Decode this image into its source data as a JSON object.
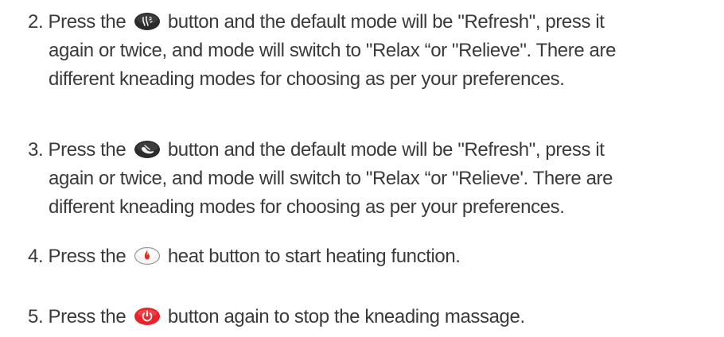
{
  "steps": [
    {
      "number": "2.",
      "lines": [
        {
          "before": "Press the",
          "after": "button and the default mode will be \"Refresh\", press it"
        },
        {
          "text": "again or twice, and mode will switch to \"Relax “or \"Relieve\". There are"
        },
        {
          "text": "different kneading modes for choosing as per your preferences."
        }
      ],
      "icon": "massage-mode-icon"
    },
    {
      "number": "3.",
      "lines": [
        {
          "before": "Press the",
          "after": "button and the default mode will be \"Refresh\", press it"
        },
        {
          "text": "again or twice, and mode will switch to \"Relax “or \"Relieve'. There are"
        },
        {
          "text": "different kneading modes for choosing as per your preferences."
        }
      ],
      "icon": "foot-massage-icon"
    },
    {
      "number": "4.",
      "lines": [
        {
          "before": "Press the",
          "after": "heat button to start heating function."
        }
      ],
      "icon": "heat-icon"
    },
    {
      "number": "5.",
      "lines": [
        {
          "before": "Press the",
          "after": "button again to stop the kneading massage."
        }
      ],
      "icon": "power-icon"
    }
  ],
  "colors": {
    "text": "#3a3a3a",
    "button_dark": "#2b2b2b",
    "heat_flame": "#e0301e",
    "power_red": "#e8232a"
  }
}
